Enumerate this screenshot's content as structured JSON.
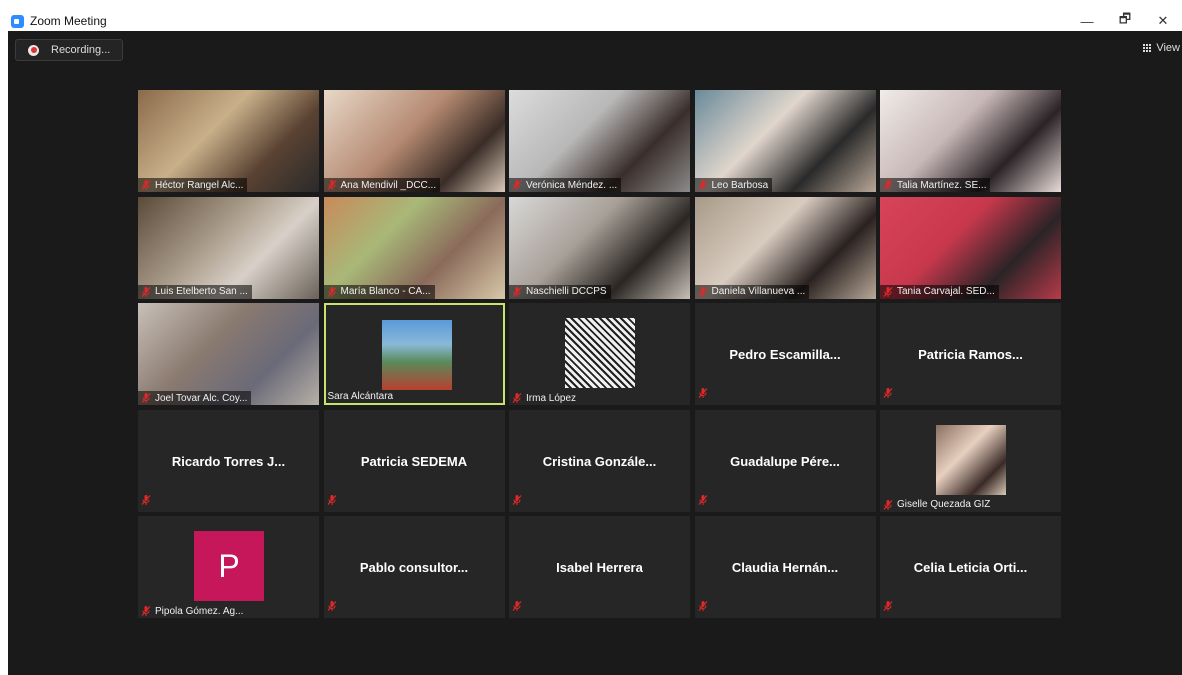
{
  "window": {
    "title": "Zoom Meeting",
    "controls": {
      "minimize": "—",
      "restore": "🗗",
      "close": "✕"
    }
  },
  "toolbar": {
    "recording_label": "Recording...",
    "view_label": "View"
  },
  "participants": [
    {
      "name": "Héctor Rangel Alc...",
      "muted": true,
      "video": true
    },
    {
      "name": "Ana Mendivil _DCC...",
      "muted": true,
      "video": true
    },
    {
      "name": "Verónica Méndez. ...",
      "muted": true,
      "video": true
    },
    {
      "name": "Leo Barbosa",
      "muted": true,
      "video": true
    },
    {
      "name": "Talia Martínez. SE...",
      "muted": true,
      "video": true
    },
    {
      "name": "Luis Etelberto San ...",
      "muted": true,
      "video": true
    },
    {
      "name": "María Blanco - CA...",
      "muted": true,
      "video": true
    },
    {
      "name": "Naschielli DCCPS",
      "muted": true,
      "video": true
    },
    {
      "name": "Daniela Villanueva ...",
      "muted": true,
      "video": true
    },
    {
      "name": "Tania Carvajal. SED...",
      "muted": true,
      "video": true
    },
    {
      "name": "Joel Tovar Alc. Coy...",
      "muted": true,
      "video": true
    },
    {
      "name": "Sara Alcántara",
      "muted": false,
      "video": false,
      "active_speaker": true
    },
    {
      "name": "Irma López",
      "muted": true,
      "video": false
    },
    {
      "name": "Pedro  Escamilla...",
      "muted": true,
      "video": false
    },
    {
      "name": "Patricia  Ramos...",
      "muted": true,
      "video": false
    },
    {
      "name": "Ricardo  Torres  J...",
      "muted": true,
      "video": false
    },
    {
      "name": "Patricia SEDEMA",
      "muted": true,
      "video": false
    },
    {
      "name": "Cristina  Gonzále...",
      "muted": true,
      "video": false
    },
    {
      "name": "Guadalupe  Pére...",
      "muted": true,
      "video": false
    },
    {
      "name": "Giselle Quezada GIZ",
      "muted": true,
      "video": false
    },
    {
      "name": "Pipola Gómez. Ag...",
      "muted": true,
      "video": false,
      "avatar_letter": "P"
    },
    {
      "name": "Pablo  consultor...",
      "muted": true,
      "video": false
    },
    {
      "name": "Isabel Herrera",
      "muted": true,
      "video": false
    },
    {
      "name": "Claudia  Hernán...",
      "muted": true,
      "video": false
    },
    {
      "name": "Celia  Leticia  Orti...",
      "muted": true,
      "video": false
    }
  ],
  "colors": {
    "background": "#1a1a1a",
    "tile": "#262626",
    "active_speaker_border": "#c8e36c",
    "muted_icon": "#e02828",
    "avatar_p": "#c7175b"
  }
}
